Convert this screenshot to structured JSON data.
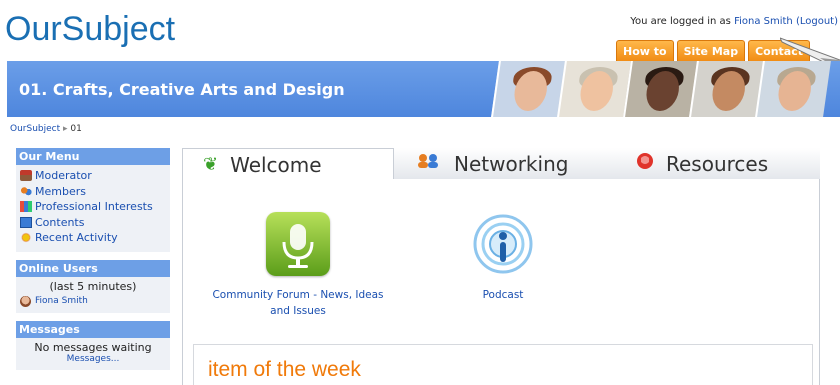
{
  "site": {
    "logo": "OurSubject"
  },
  "login": {
    "prefix": "You are logged in as",
    "user": "Fiona Smith",
    "logout": "(Logout)"
  },
  "top_tabs": [
    "How to",
    "Site Map",
    "Contact"
  ],
  "banner": {
    "title": "01. Crafts, Creative Arts and Design"
  },
  "breadcrumb": {
    "root": "OurSubject",
    "sep": "▸",
    "current": "01"
  },
  "sidebar": {
    "menu": {
      "title": "Our Menu",
      "items": [
        {
          "label": "Moderator",
          "icon": "moderator-icon"
        },
        {
          "label": "Members",
          "icon": "members-icon"
        },
        {
          "label": "Professional Interests",
          "icon": "interests-icon"
        },
        {
          "label": "Contents",
          "icon": "contents-icon"
        },
        {
          "label": "Recent Activity",
          "icon": "activity-icon"
        }
      ]
    },
    "online": {
      "title": "Online Users",
      "note": "(last 5 minutes)",
      "user": "Fiona Smith"
    },
    "messages": {
      "title": "Messages",
      "status": "No messages waiting",
      "link": "Messages..."
    }
  },
  "tabs": [
    {
      "label": "Welcome",
      "icon": "leaf-icon"
    },
    {
      "label": "Networking",
      "icon": "people-icon"
    },
    {
      "label": "Resources",
      "icon": "resources-icon"
    }
  ],
  "apps": [
    {
      "label_line1": "Community Forum - News, Ideas",
      "label_line2": "and Issues",
      "icon": "microphone-icon"
    },
    {
      "label_line1": "Podcast",
      "icon": "podcast-icon"
    }
  ],
  "item_of_week": {
    "title": "item of the week"
  },
  "colors": {
    "brand": "#1a6fb3",
    "banner": "#5b8fe2",
    "orange": "#f08a12",
    "link": "#1a4fb0"
  }
}
